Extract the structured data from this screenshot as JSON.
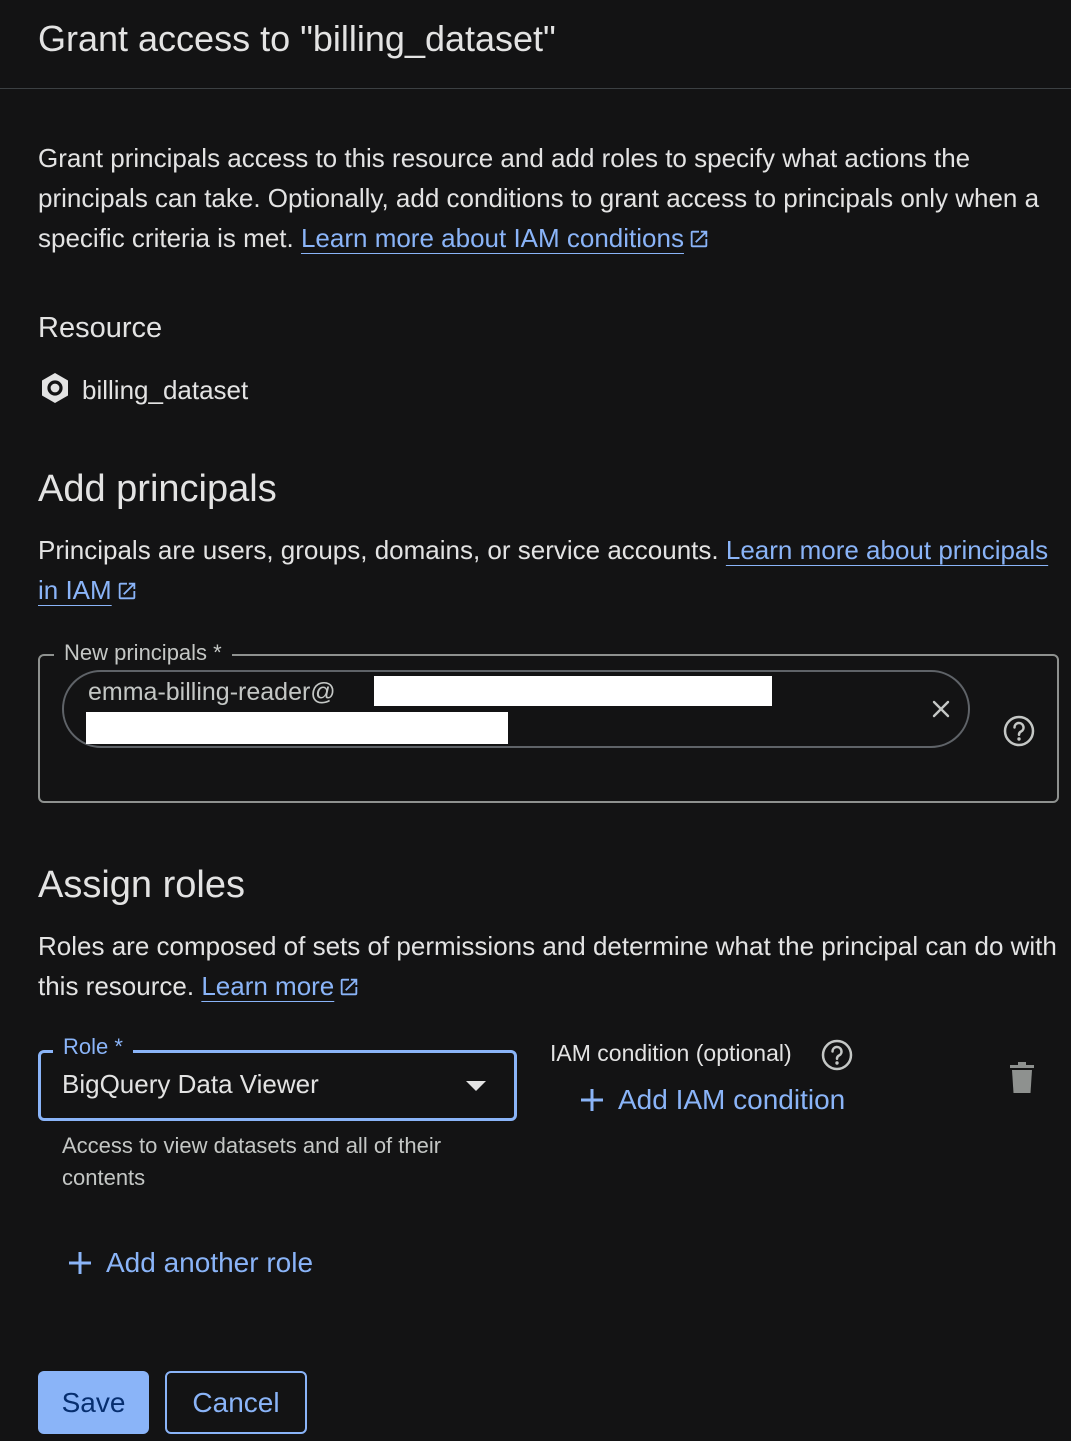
{
  "header": {
    "title": "Grant access to \"billing_dataset\""
  },
  "intro": {
    "text": "Grant principals access to this resource and add roles to specify what actions the principals can take. Optionally, add conditions to grant access to principals only when a specific criteria is met.",
    "link_label": "Learn more about IAM conditions"
  },
  "resource": {
    "heading": "Resource",
    "name": "billing_dataset",
    "icon": "bigquery-dataset-icon"
  },
  "principals": {
    "heading": "Add principals",
    "description": "Principals are users, groups, domains, or service accounts.",
    "link_label": "Learn more about principals in IAM",
    "field_label": "New principals *",
    "chip_value": "emma-billing-reader@"
  },
  "roles": {
    "heading": "Assign roles",
    "description": "Roles are composed of sets of permissions and determine what the principal can do with this resource.",
    "link_label": "Learn more",
    "role_label": "Role *",
    "role_value": "BigQuery Data Viewer",
    "role_help": "Access to view datasets and all of their contents",
    "condition_label": "IAM condition (optional)",
    "add_condition_label": "Add IAM condition",
    "add_role_label": "Add another role"
  },
  "actions": {
    "save_label": "Save",
    "cancel_label": "Cancel"
  },
  "colors": {
    "background": "#131314",
    "accent": "#8ab4f8",
    "text": "#e3e3e3"
  }
}
